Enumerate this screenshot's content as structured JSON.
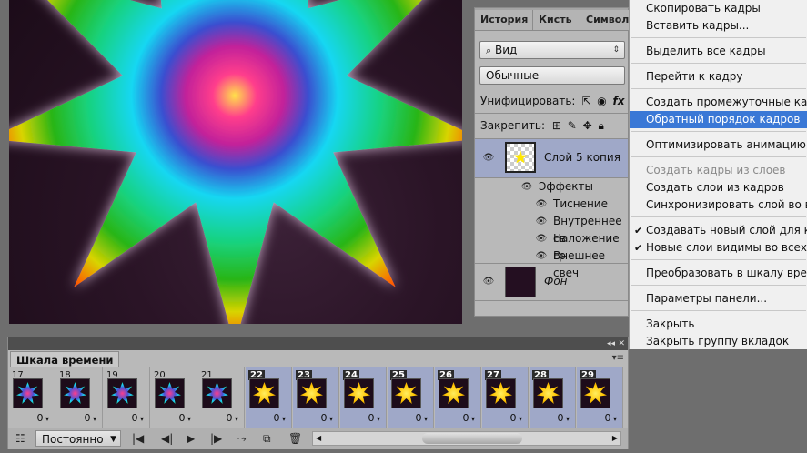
{
  "layers_panel": {
    "tabs": [
      "История",
      "Кисть",
      "Символ"
    ],
    "filter_kind": "Вид",
    "blend_mode": "Обычные",
    "unify_label": "Унифицировать:",
    "lock_label": "Закрепить:",
    "layers": [
      {
        "name": "Слой 5 копия",
        "selected": true
      },
      {
        "name": "Фон",
        "selected": false
      }
    ],
    "effects_label": "Эффекты",
    "effects": [
      "Тиснение",
      "Внутреннее св",
      "Наложение гр",
      "Внешнее свеч"
    ]
  },
  "menu": {
    "items": [
      {
        "label": "Скопировать кадры",
        "state": "normal"
      },
      {
        "label": "Вставить кадры...",
        "state": "normal"
      },
      {
        "label": "Выделить все кадры",
        "state": "normal"
      },
      {
        "label": "Перейти к кадру",
        "state": "normal"
      },
      {
        "label": "Создать промежуточные кадры...",
        "state": "normal"
      },
      {
        "label": "Обратный порядок кадров",
        "state": "highlighted"
      },
      {
        "label": "Оптимизировать анимацию...",
        "state": "normal"
      },
      {
        "label": "Создать кадры из слоев",
        "state": "disabled"
      },
      {
        "label": "Создать слои из кадров",
        "state": "normal"
      },
      {
        "label": "Синхронизировать слой во всех",
        "state": "normal"
      },
      {
        "label": "Создавать новый слой для кажд",
        "state": "checked"
      },
      {
        "label": "Новые слои видимы во всех кад",
        "state": "checked"
      },
      {
        "label": "Преобразовать в шкалу времени",
        "state": "normal"
      },
      {
        "label": "Параметры панели...",
        "state": "normal"
      },
      {
        "label": "Закрыть",
        "state": "normal"
      },
      {
        "label": "Закрыть группу вкладок",
        "state": "normal"
      }
    ]
  },
  "timeline": {
    "tab_label": "Шкала времени",
    "loop_option": "Постоянно",
    "frames": [
      {
        "n": "17",
        "delay": "0",
        "selected": false,
        "kind": "star"
      },
      {
        "n": "18",
        "delay": "0",
        "selected": false,
        "kind": "star"
      },
      {
        "n": "19",
        "delay": "0",
        "selected": false,
        "kind": "star"
      },
      {
        "n": "20",
        "delay": "0",
        "selected": false,
        "kind": "star"
      },
      {
        "n": "21",
        "delay": "0",
        "selected": false,
        "kind": "star"
      },
      {
        "n": "22",
        "delay": "0",
        "selected": true,
        "kind": "sun"
      },
      {
        "n": "23",
        "delay": "0",
        "selected": true,
        "kind": "sun"
      },
      {
        "n": "24",
        "delay": "0",
        "selected": true,
        "kind": "sun"
      },
      {
        "n": "25",
        "delay": "0",
        "selected": true,
        "kind": "sun"
      },
      {
        "n": "26",
        "delay": "0",
        "selected": true,
        "kind": "sun"
      },
      {
        "n": "27",
        "delay": "0",
        "selected": true,
        "kind": "sun"
      },
      {
        "n": "28",
        "delay": "0",
        "selected": true,
        "kind": "sun"
      },
      {
        "n": "29",
        "delay": "0",
        "selected": true,
        "kind": "sun"
      }
    ]
  }
}
